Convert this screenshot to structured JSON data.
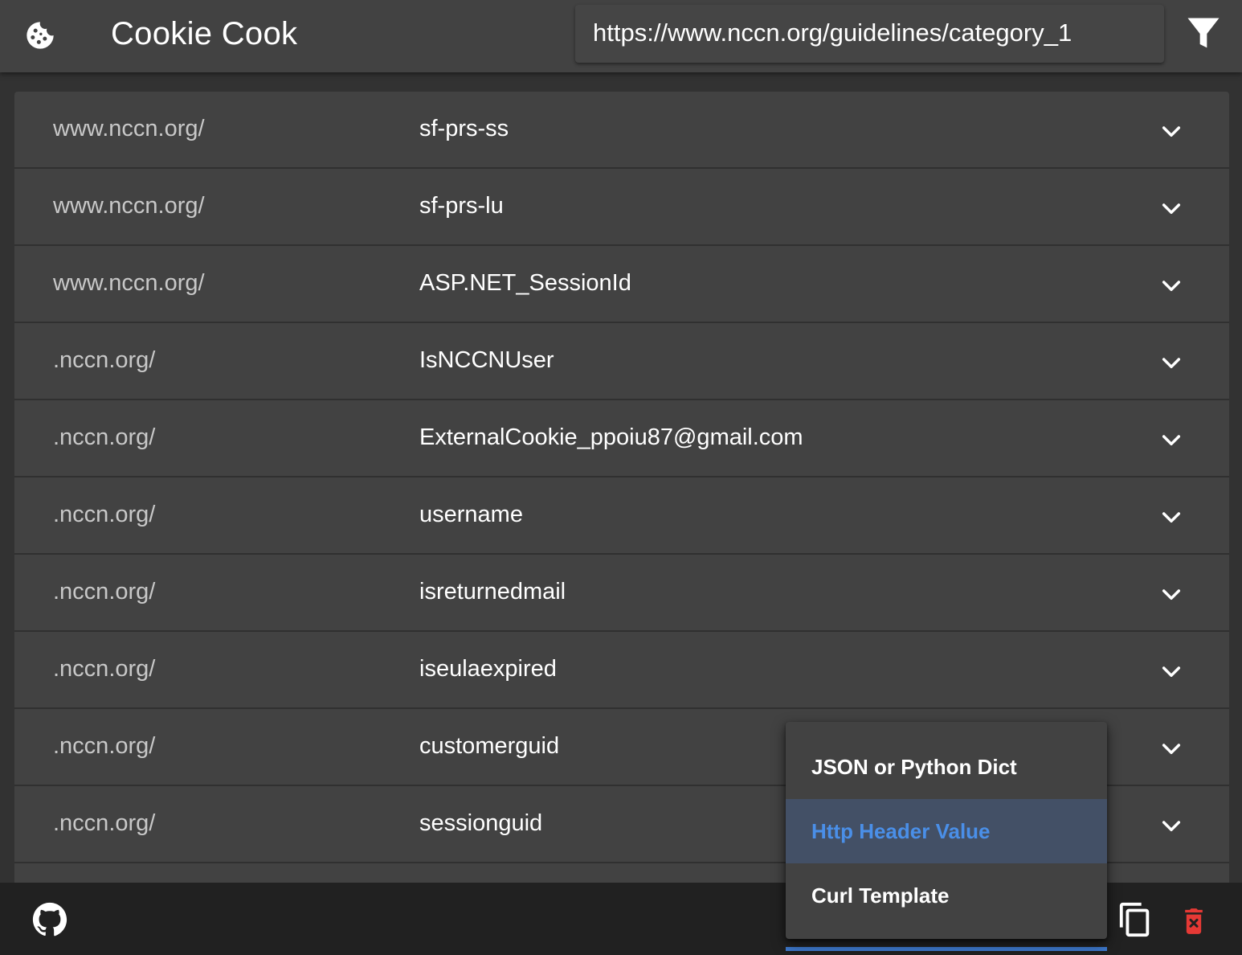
{
  "header": {
    "title": "Cookie Cook",
    "url_value": "https://www.nccn.org/guidelines/category_1",
    "logo_icon": "cookie-icon",
    "filter_icon": "filter-icon"
  },
  "cookies": [
    {
      "domain": "www.nccn.org/",
      "name": "sf-prs-ss"
    },
    {
      "domain": "www.nccn.org/",
      "name": "sf-prs-lu"
    },
    {
      "domain": "www.nccn.org/",
      "name": "ASP.NET_SessionId"
    },
    {
      "domain": ".nccn.org/",
      "name": "IsNCCNUser"
    },
    {
      "domain": ".nccn.org/",
      "name": "ExternalCookie_ppoiu87@gmail.com"
    },
    {
      "domain": ".nccn.org/",
      "name": "username"
    },
    {
      "domain": ".nccn.org/",
      "name": "isreturnedmail"
    },
    {
      "domain": ".nccn.org/",
      "name": "iseulaexpired"
    },
    {
      "domain": ".nccn.org/",
      "name": "customerguid"
    },
    {
      "domain": ".nccn.org/",
      "name": "sessionguid"
    }
  ],
  "format_menu": {
    "items": [
      {
        "label": "JSON or Python Dict",
        "selected": false
      },
      {
        "label": "Http Header Value",
        "selected": true
      },
      {
        "label": "Curl Template",
        "selected": false
      }
    ]
  },
  "footer": {
    "github_icon": "github-icon",
    "copy_icon": "copy-icon",
    "delete_icon": "delete-icon"
  },
  "colors": {
    "background": "#323232",
    "surface": "#424242",
    "accent": "#4a8fe8",
    "selected_bg": "#435066",
    "danger": "#e53935"
  }
}
